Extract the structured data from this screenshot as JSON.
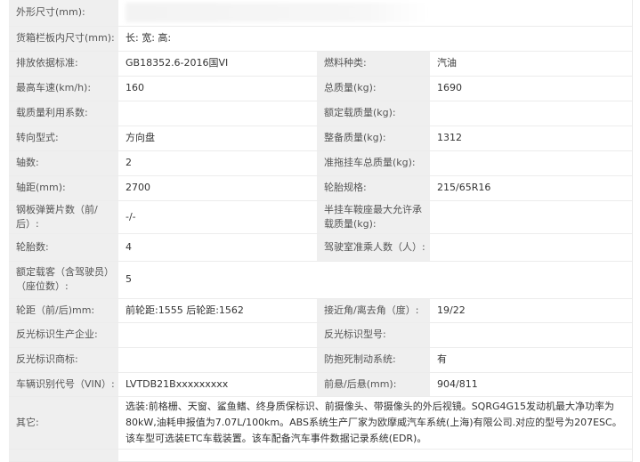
{
  "rows": [
    {
      "label": "外形尺寸(mm):",
      "value": ""
    },
    {
      "label": "货箱栏板内尺寸(mm):",
      "value": "长:  宽:  高:"
    },
    {
      "label": "排放依据标准:",
      "value": "GB18352.6-2016国VI",
      "label2": "燃料种类:",
      "value2": "汽油"
    },
    {
      "label": "最高车速(km/h):",
      "value": "160",
      "label2": "总质量(kg):",
      "value2": "1690"
    },
    {
      "label": "载质量利用系数:",
      "value": "",
      "label2": "额定载质量(kg):",
      "value2": ""
    },
    {
      "label": "转向型式:",
      "value": "方向盘",
      "label2": "整备质量(kg):",
      "value2": "1312"
    },
    {
      "label": "轴数:",
      "value": "2",
      "label2": "准拖挂车总质量(kg):",
      "value2": ""
    },
    {
      "label": "轴距(mm):",
      "value": "2700",
      "label2": "轮胎规格:",
      "value2": "215/65R16"
    },
    {
      "label": "钢板弹簧片数（前/后）:",
      "value": "-/-",
      "label2": "半挂车鞍座最大允许承载质量(kg):",
      "value2": ""
    },
    {
      "label": "轮胎数:",
      "value": "4",
      "label2": "驾驶室准乘人数（人）:",
      "value2": ""
    },
    {
      "label": "额定载客（含驾驶员）（座位数）:",
      "value": "5"
    },
    {
      "label": "轮距（前/后)mm:",
      "value": "前轮距:1555 后轮距:1562",
      "label2": "接近角/离去角（度）:",
      "value2": "19/22"
    },
    {
      "label": "反光标识生产企业:",
      "value": "",
      "label2": "反光标识型号:",
      "value2": ""
    },
    {
      "label": "反光标识商标:",
      "value": "",
      "label2": "防抱死制动系统:",
      "value2": "有"
    },
    {
      "label": "车辆识别代号（VIN）:",
      "value": "LVTDB21Bxxxxxxxxx",
      "label2": "前悬/后悬(mm):",
      "value2": "904/811"
    },
    {
      "label": "其它:",
      "value": "选装:前格栅、天窗、鲨鱼鳍、终身质保标识、前摄像头、带摄像头的外后视镜。SQRG4G15发动机最大净功率为80kW,油耗申报值为7.07L/100km。ABS系统生产厂家为欧摩威汽车系统(上海)有限公司.对应的型号为207ESC。该车型可选装ETC车载装置。该车配备汽车事件数据记录系统(EDR)。"
    }
  ]
}
